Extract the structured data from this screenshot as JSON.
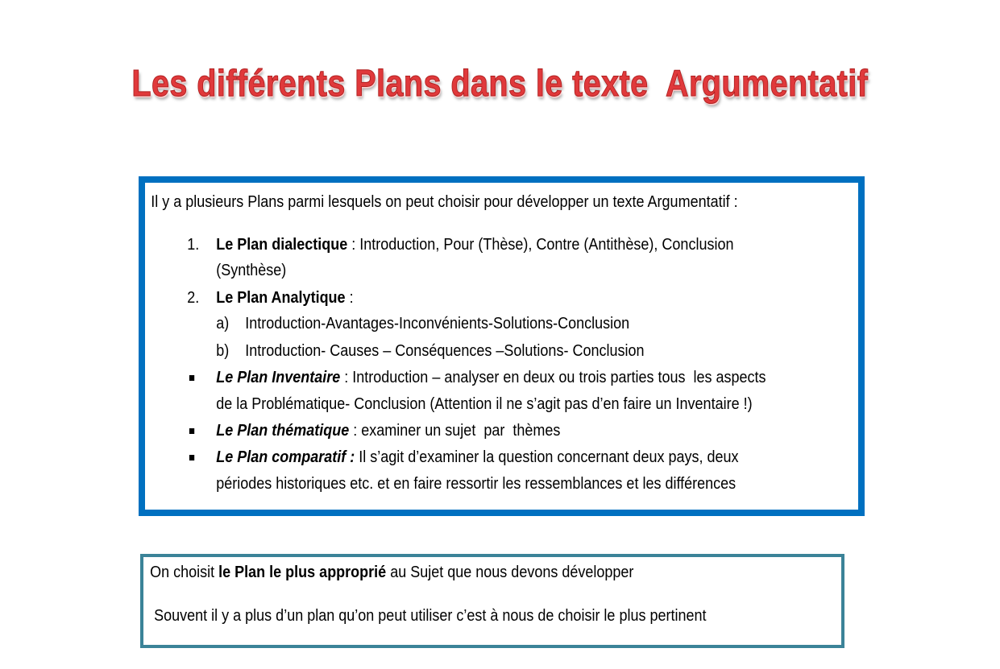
{
  "title": "Les différents Plans dans le texte  Argumentatif",
  "box1": {
    "intro": "Il y a plusieurs Plans parmi lesquels on peut choisir pour développer un texte Argumentatif :",
    "item1": {
      "marker": "1.",
      "bold": "Le Plan dialectique",
      "text": " : Introduction, Pour (Thèse), Contre (Antithèse), Conclusion",
      "cont": "(Synthèse)"
    },
    "item2": {
      "marker": "2.",
      "bold": "Le Plan Analytique",
      "text": " :",
      "subs": [
        {
          "marker": "a)",
          "text": "Introduction-Avantages-Inconvénients-Solutions-Conclusion"
        },
        {
          "marker": "b)",
          "text": "Introduction- Causes – Conséquences –Solutions- Conclusion"
        }
      ]
    },
    "bullet1": {
      "bold": "Le Plan Inventaire",
      "text": " : Introduction – analyser en deux ou trois parties tous  les aspects",
      "cont": "de la Problématique- Conclusion (Attention il ne s’agit pas d’en faire un Inventaire !)"
    },
    "bullet2": {
      "bold": "Le Plan thématique",
      "text": " : examiner un sujet  par  thèmes"
    },
    "bullet3": {
      "bold": "Le Plan comparatif :",
      "text": " Il s’agit d’examiner la question concernant deux pays, deux",
      "cont": "périodes historiques etc. et en faire ressortir les ressemblances et les différences"
    }
  },
  "box2": {
    "line1_pre": "On choisit ",
    "line1_bold": "le Plan le plus approprié",
    "line1_post": " au Sujet que nous devons développer",
    "line2": " Souvent il y a plus d’un plan qu’on peut utiliser c’est à nous de choisir le plus pertinent"
  },
  "colors": {
    "title": "#e0393b",
    "box1_border": "#0070c0",
    "box2_border": "#3b8398"
  }
}
